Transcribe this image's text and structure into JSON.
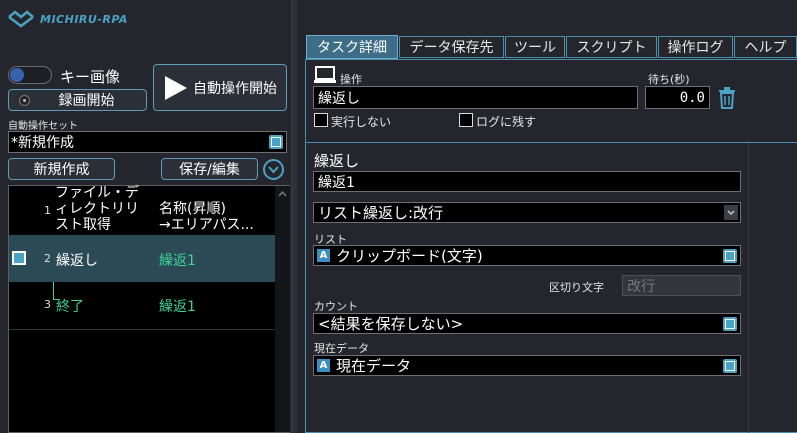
{
  "app": {
    "logo_text": "MICHIRU-RPA"
  },
  "left": {
    "key_image_label": "キー画像",
    "record_label": "録画開始",
    "start_label": "自動操作開始",
    "set_label": "自動操作セット",
    "set_value": "*新規作成",
    "new_button": "新規作成",
    "save_edit_button": "保存/編集"
  },
  "table": {
    "col_num": "1",
    "col_file": "ファイル・ディレクトリリスト取得",
    "col_file_lines": [
      "ファイル・デ",
      "ィレクトリリ",
      "スト取得"
    ],
    "col_name_lines": [
      "名称(昇順)",
      "→エリアパス..."
    ],
    "rows": [
      {
        "num": "2",
        "task": "繰返し",
        "name": "繰返1"
      },
      {
        "num": "3",
        "task": "終了",
        "name": "繰返1"
      }
    ]
  },
  "tabs": [
    "タスク詳細",
    "データ保存先",
    "ツール",
    "スクリプト",
    "操作ログ",
    "ヘルプ"
  ],
  "detail": {
    "operation_label": "操作",
    "operation_value": "繰返し",
    "wait_label": "待ち(秒)",
    "wait_value": "0.0",
    "no_exec_label": "実行しない",
    "keep_log_label": "ログに残す",
    "section_title": "繰返し",
    "name_value": "繰返1",
    "mode_value": "リスト繰返し:改行",
    "list_label": "リスト",
    "list_value": "クリップボード(文字)",
    "delimiter_label": "区切り文字",
    "delimiter_value": "改行",
    "count_label": "カウント",
    "count_value": "<結果を保存しない>",
    "current_label": "現在データ",
    "current_value": "現在データ",
    "a_badge": "A"
  },
  "colors": {
    "accent": "#4aa2c4",
    "bg": "#25262d",
    "selected_row": "#2b4a55",
    "green_text": "#3ed39b"
  }
}
